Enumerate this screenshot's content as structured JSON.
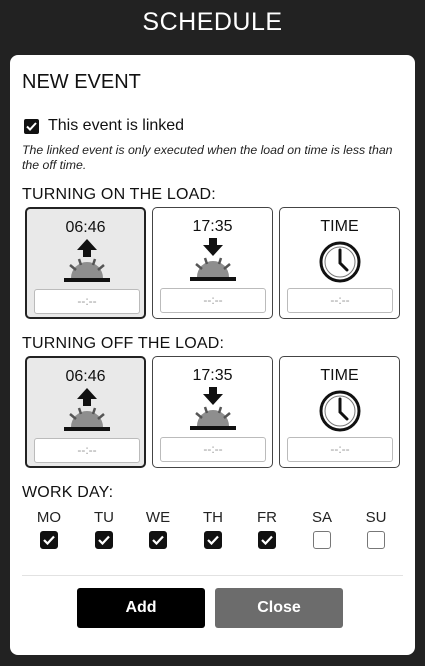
{
  "app": {
    "title": "SCHEDULE"
  },
  "event": {
    "title": "NEW EVENT",
    "linked_label": "This event is linked",
    "linked_checked": true,
    "note": "The linked event is only executed when the load on time is less than the off time."
  },
  "turn_on": {
    "title": "TURNING ON THE LOAD:",
    "options": [
      {
        "label": "06:46",
        "icon": "sunrise-icon",
        "placeholder": "--:--",
        "selected": true
      },
      {
        "label": "17:35",
        "icon": "sunset-icon",
        "placeholder": "--:--",
        "selected": false
      },
      {
        "label": "TIME",
        "icon": "clock-icon",
        "placeholder": "--:--",
        "selected": false
      }
    ]
  },
  "turn_off": {
    "title": "TURNING OFF THE LOAD:",
    "options": [
      {
        "label": "06:46",
        "icon": "sunrise-icon",
        "placeholder": "--:--",
        "selected": true
      },
      {
        "label": "17:35",
        "icon": "sunset-icon",
        "placeholder": "--:--",
        "selected": false
      },
      {
        "label": "TIME",
        "icon": "clock-icon",
        "placeholder": "--:--",
        "selected": false
      }
    ]
  },
  "workday": {
    "title": "WORK DAY:",
    "days": [
      {
        "label": "MO",
        "checked": true
      },
      {
        "label": "TU",
        "checked": true
      },
      {
        "label": "WE",
        "checked": true
      },
      {
        "label": "TH",
        "checked": true
      },
      {
        "label": "FR",
        "checked": true
      },
      {
        "label": "SA",
        "checked": false
      },
      {
        "label": "SU",
        "checked": false
      }
    ]
  },
  "buttons": {
    "add": "Add",
    "close": "Close"
  },
  "colors": {
    "background": "#222222",
    "panel": "#ffffff",
    "add_button": "#000000",
    "close_button": "#6c6c6c",
    "selected_tile": "#e9e9e9"
  }
}
